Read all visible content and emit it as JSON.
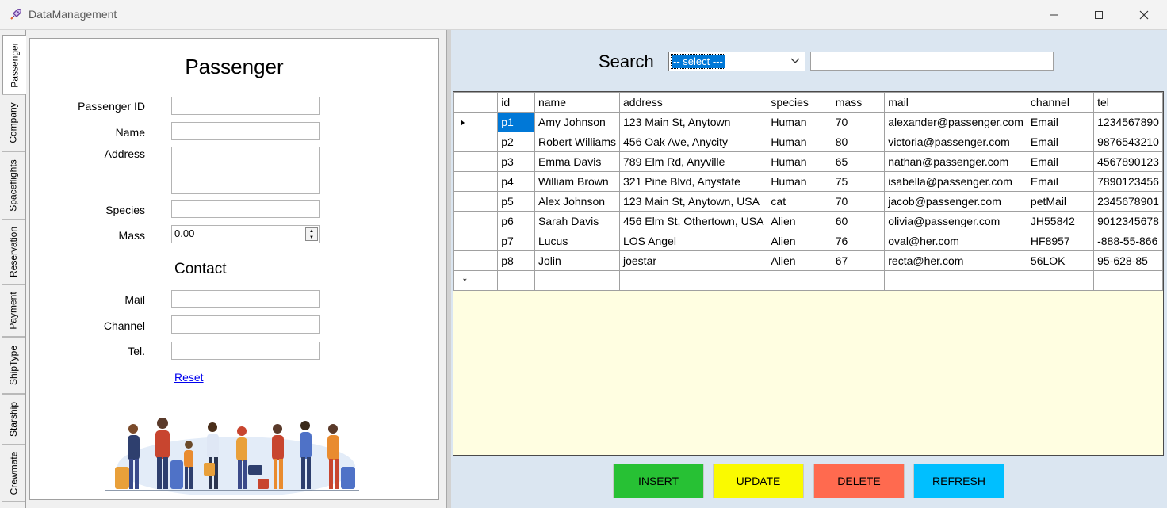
{
  "window": {
    "title": "DataManagement"
  },
  "tabs": [
    "Passenger",
    "Company",
    "Spaceflights",
    "Reservation",
    "Payment",
    "ShipType",
    "Starship",
    "Crewmate"
  ],
  "form": {
    "title": "Passenger",
    "labels": {
      "passenger_id": "Passenger ID",
      "name": "Name",
      "address": "Address",
      "species": "Species",
      "mass": "Mass",
      "mail": "Mail",
      "channel": "Channel",
      "tel": "Tel."
    },
    "mass_value": "0.00",
    "contact_title": "Contact",
    "reset_label": "Reset"
  },
  "search": {
    "label": "Search",
    "combo_value": "-- select ---"
  },
  "grid": {
    "columns": [
      "id",
      "name",
      "address",
      "species",
      "mass",
      "mail",
      "channel",
      "tel"
    ],
    "rows": [
      [
        "p1",
        "Amy Johnson",
        "123 Main St, Anytown",
        "Human",
        "70",
        "alexander@passenger.com",
        "Email",
        "1234567890"
      ],
      [
        "p2",
        "Robert Williams",
        "456 Oak Ave, Anycity",
        "Human",
        "80",
        "victoria@passenger.com",
        "Email",
        "9876543210"
      ],
      [
        "p3",
        "Emma Davis",
        "789 Elm Rd, Anyville",
        "Human",
        "65",
        "nathan@passenger.com",
        "Email",
        "4567890123"
      ],
      [
        "p4",
        "William Brown",
        "321 Pine Blvd, Anystate",
        "Human",
        "75",
        "isabella@passenger.com",
        "Email",
        "7890123456"
      ],
      [
        "p5",
        "Alex Johnson",
        "123 Main St, Anytown, USA",
        "cat",
        "70",
        "jacob@passenger.com",
        "petMail",
        "2345678901"
      ],
      [
        "p6",
        "Sarah Davis",
        "456 Elm St, Othertown, USA",
        "Alien",
        "60",
        "olivia@passenger.com",
        "JH55842",
        "9012345678"
      ],
      [
        "p7",
        "Lucus",
        "LOS Angel",
        "Alien",
        "76",
        "oval@her.com",
        "HF8957",
        "-888-55-866"
      ],
      [
        "p8",
        "Jolin",
        "joestar",
        "Alien",
        "67",
        "recta@her.com",
        "56LOK",
        "95-628-85"
      ]
    ],
    "new_row_marker": "*"
  },
  "buttons": {
    "insert": "INSERT",
    "update": "UPDATE",
    "delete": "DELETE",
    "refresh": "REFRESH"
  },
  "colors": {
    "insert": "#27c134",
    "update": "#fafa00",
    "delete": "#ff6a4f",
    "refresh": "#00bfff",
    "selection": "#0078d7",
    "grid_background": "#fffee1",
    "pane_background": "#dbe6f1"
  }
}
